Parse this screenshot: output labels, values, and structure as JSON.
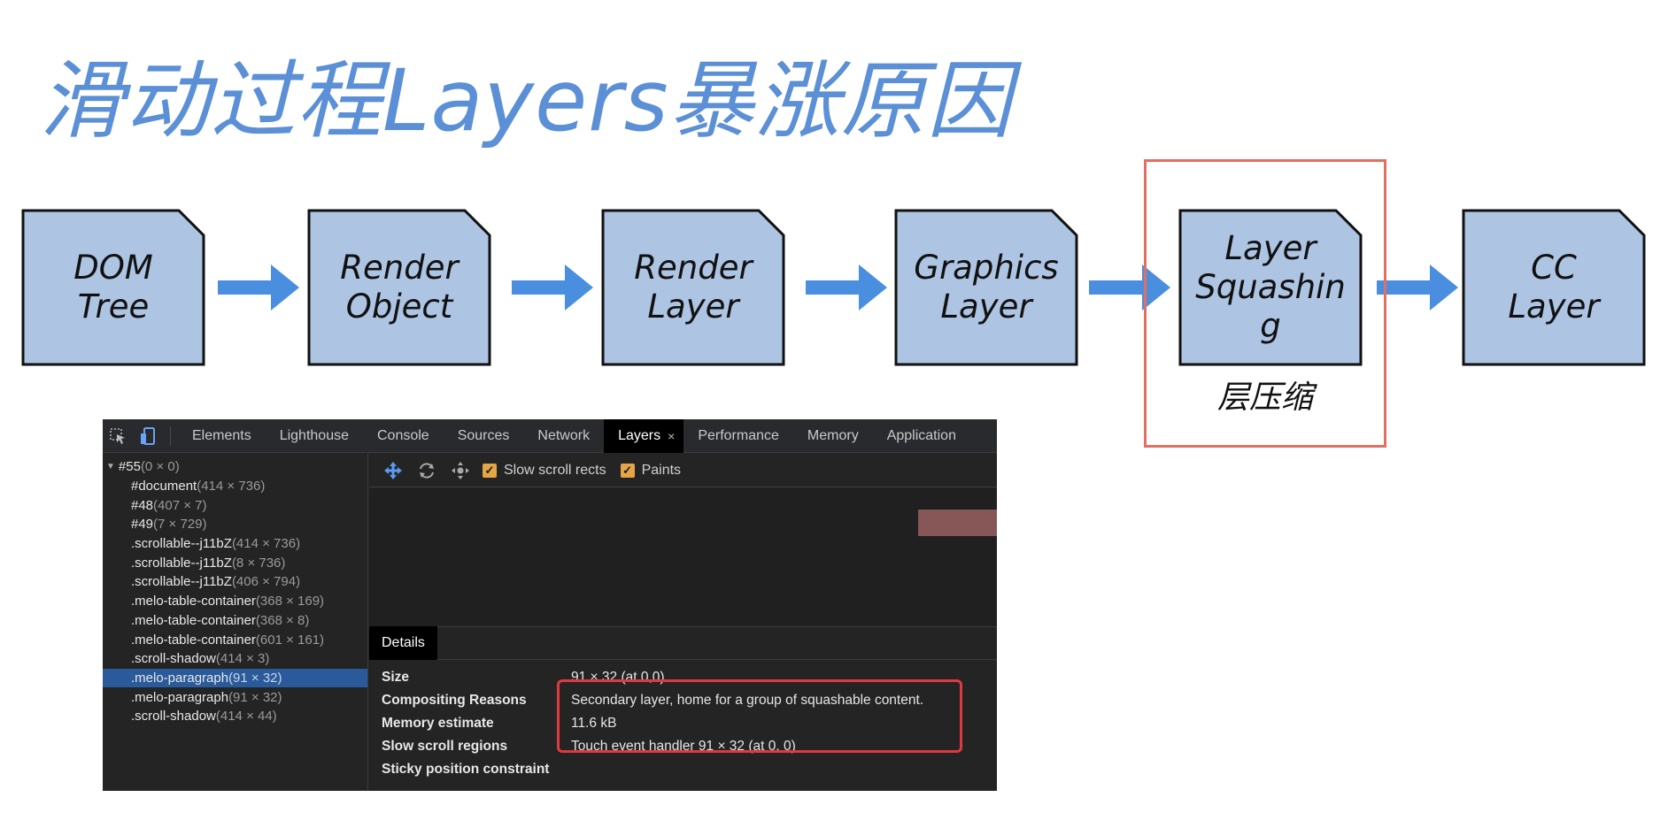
{
  "slide": {
    "title": "滑动过程Layers暴涨原因"
  },
  "flow": [
    {
      "label": "DOM\nTree"
    },
    {
      "label": "Render\nObject"
    },
    {
      "label": "Render\nLayer"
    },
    {
      "label": "Graphics\nLayer"
    },
    {
      "label": "Layer\nSquashin\ng"
    },
    {
      "label": "CC\nLayer"
    }
  ],
  "squash_caption": "层压缩",
  "colors": {
    "box_fill": "#adc4e3",
    "arrow": "#4a8fdf",
    "highlight": "#e36f5e",
    "title": "#5b8fd6",
    "alert_outline": "#e0393f"
  },
  "devtools": {
    "tabs": [
      {
        "label": "Elements"
      },
      {
        "label": "Lighthouse"
      },
      {
        "label": "Console"
      },
      {
        "label": "Sources"
      },
      {
        "label": "Network"
      },
      {
        "label": "Layers",
        "active": true
      },
      {
        "label": "Performance"
      },
      {
        "label": "Memory"
      },
      {
        "label": "Application"
      }
    ],
    "tab_close": "×",
    "tool_icons": [
      "inspect-icon",
      "device-toggle-icon"
    ],
    "tree": [
      {
        "name": "#55",
        "size": "(0 × 0)"
      },
      {
        "name": "#document",
        "size": "(414 × 736)"
      },
      {
        "name": "#48",
        "size": "(407 × 7)"
      },
      {
        "name": "#49",
        "size": "(7 × 729)"
      },
      {
        "name": ".scrollable--j11bZ",
        "size": "(414 × 736)"
      },
      {
        "name": ".scrollable--j11bZ",
        "size": "(8 × 736)"
      },
      {
        "name": ".scrollable--j11bZ",
        "size": "(406 × 794)"
      },
      {
        "name": ".melo-table-container",
        "size": "(368 × 169)"
      },
      {
        "name": ".melo-table-container",
        "size": "(368 × 8)"
      },
      {
        "name": ".melo-table-container",
        "size": "(601 × 161)"
      },
      {
        "name": ".scroll-shadow",
        "size": "(414 × 3)"
      },
      {
        "name": ".melo-paragraph",
        "size": "(91 × 32)",
        "selected": true
      },
      {
        "name": ".melo-paragraph",
        "size": "(91 × 32)"
      },
      {
        "name": ".scroll-shadow",
        "size": "(414 × 44)"
      }
    ],
    "toolbar": {
      "icons": [
        "pan-icon",
        "rotate-icon",
        "reset-transform-icon"
      ],
      "slow_scroll_label": "Slow scroll rects",
      "paints_label": "Paints",
      "check": "✓"
    },
    "details_tab": "Details",
    "details": [
      {
        "key": "Size",
        "value": "91 × 32 (at 0,0)"
      },
      {
        "key": "Compositing Reasons",
        "value": "Secondary layer, home for a group of squashable content."
      },
      {
        "key": "Memory estimate",
        "value": "11.6 kB"
      },
      {
        "key": "Slow scroll regions",
        "value": "Touch event handler 91 × 32 (at 0, 0)"
      },
      {
        "key": "Sticky position constraint",
        "value": ""
      }
    ]
  }
}
